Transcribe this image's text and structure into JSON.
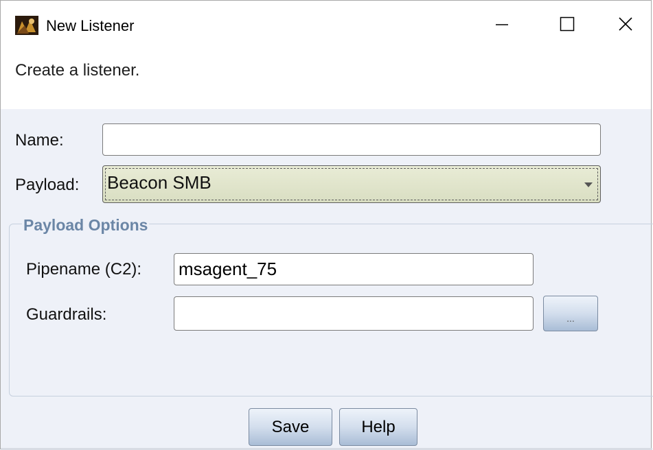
{
  "window": {
    "title": "New Listener",
    "controls": {
      "minimize_icon": "minimize-icon",
      "maximize_icon": "maximize-icon",
      "close_icon": "close-icon"
    }
  },
  "header": {
    "text": "Create a listener."
  },
  "form": {
    "name": {
      "label": "Name:",
      "value": ""
    },
    "payload": {
      "label": "Payload:",
      "selected": "Beacon SMB"
    },
    "payload_options": {
      "title": "Payload Options",
      "pipename": {
        "label": "Pipename (C2):",
        "value": "msagent_75"
      },
      "guardrails": {
        "label": "Guardrails:",
        "value": "",
        "browse_label": "..."
      }
    }
  },
  "buttons": {
    "save": "Save",
    "help": "Help"
  },
  "colors": {
    "window_bg": "#eef1f8",
    "group_title": "#6b86a6",
    "combo_bg": "#e3e7cf"
  }
}
